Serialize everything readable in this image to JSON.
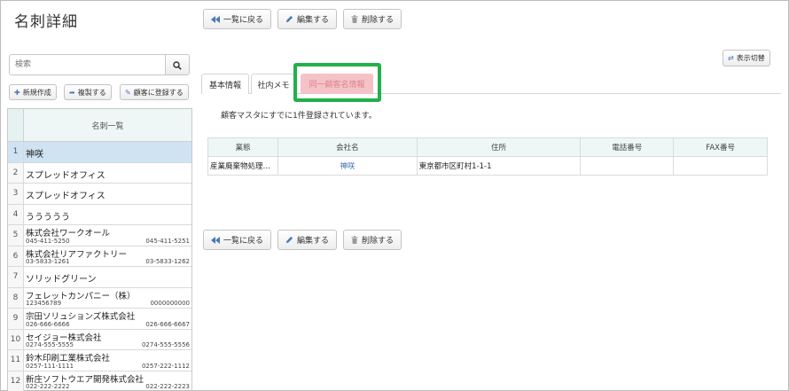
{
  "page": {
    "title": "名刺詳細"
  },
  "toolbar": {
    "back_label": "一覧に戻る",
    "edit_label": "編集する",
    "delete_label": "削除する"
  },
  "search": {
    "placeholder": "検索"
  },
  "sidebar_buttons": {
    "new_label": "新規作成",
    "copy_label": "複製する",
    "register_label": "顧客に登録する"
  },
  "card_list": {
    "header": "名刺一覧",
    "rows": [
      {
        "num": "1",
        "name": "神咲",
        "tel1": "",
        "tel2": ""
      },
      {
        "num": "2",
        "name": "スプレッドオフィス",
        "tel1": "",
        "tel2": ""
      },
      {
        "num": "3",
        "name": "スプレッドオフィス",
        "tel1": "",
        "tel2": ""
      },
      {
        "num": "4",
        "name": "ううううう",
        "tel1": "",
        "tel2": ""
      },
      {
        "num": "5",
        "name": "株式会社ワークオール",
        "tel1": "045-411-5250",
        "tel2": "045-411-5251"
      },
      {
        "num": "6",
        "name": "株式会社リアファクトリー",
        "tel1": "03-5833-1261",
        "tel2": "03-5833-1262"
      },
      {
        "num": "7",
        "name": "ソリッドグリーン",
        "tel1": "",
        "tel2": ""
      },
      {
        "num": "8",
        "name": "フェレットカンパニー（株）",
        "tel1": "123456789",
        "tel2": "0000000000"
      },
      {
        "num": "9",
        "name": "宗田ソリュションズ株式会社",
        "tel1": "026-666-6666",
        "tel2": "026-666-6667"
      },
      {
        "num": "10",
        "name": "セイジョー株式会社",
        "tel1": "0274-555-5555",
        "tel2": "0274-555-5556"
      },
      {
        "num": "11",
        "name": "鈴木印刷工業株式会社",
        "tel1": "0257-111-1111",
        "tel2": "0257-222-1112"
      },
      {
        "num": "12",
        "name": "新庄ソフトウエア開発株式会社",
        "tel1": "022-222-2222",
        "tel2": "022-222-2223"
      }
    ]
  },
  "display_toggle": {
    "label": "表示切替"
  },
  "tabs": [
    {
      "label": "基本情報"
    },
    {
      "label": "社内メモ"
    },
    {
      "label": "同一顧客名情報"
    }
  ],
  "notice": "顧客マスタにすでに1件登録されています。",
  "customer_table": {
    "headers": [
      "業態",
      "会社名",
      "住所",
      "電話番号",
      "FAX番号"
    ],
    "rows": [
      [
        "産業廃棄物処理…",
        "神咲",
        "東京都市区町村1-1-1",
        "",
        ""
      ]
    ]
  },
  "colors": {
    "accent": "#4a78b8",
    "selected_row": "#cfe3f2",
    "active_tab": "#f5c2c7",
    "highlight": "#22b04b"
  }
}
